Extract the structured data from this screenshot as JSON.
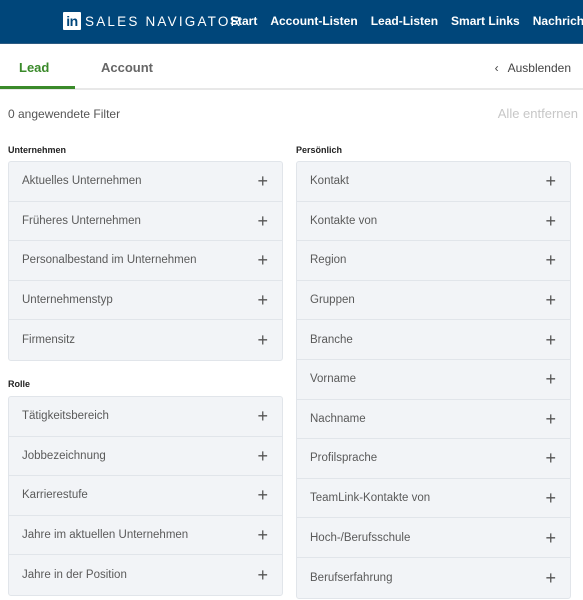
{
  "header": {
    "logo_text": "in",
    "brand": "SALES NAVIGATOR",
    "nav": [
      "Start",
      "Account-Listen",
      "Lead-Listen",
      "Smart Links",
      "Nachrichten"
    ],
    "bg_color": "#00467a"
  },
  "tabs": {
    "items": [
      "Lead",
      "Account"
    ],
    "active": "Lead",
    "accent_color": "#3a8a2a",
    "hide_label": "Ausblenden"
  },
  "filters": {
    "applied_count_text": "0 angewendete Filter",
    "remove_all": "Alle entfernen"
  },
  "sections": {
    "company": {
      "title": "Unternehmen",
      "items": [
        "Aktuelles Unternehmen",
        "Früheres Unternehmen",
        "Personalbestand im Unternehmen",
        "Unternehmenstyp",
        "Firmensitz"
      ]
    },
    "role": {
      "title": "Rolle",
      "items": [
        "Tätigkeitsbereich",
        "Jobbezeichnung",
        "Karrierestufe",
        "Jahre im aktuellen Unternehmen",
        "Jahre in der Position"
      ]
    },
    "personal": {
      "title": "Persönlich",
      "items": [
        "Kontakt",
        "Kontakte von",
        "Region",
        "Gruppen",
        "Branche",
        "Vorname",
        "Nachname",
        "Profilsprache",
        "TeamLink-Kontakte von",
        "Hoch-/Berufsschule",
        "Berufserfahrung"
      ]
    }
  },
  "icons": {
    "add": "+",
    "chevron_left": "‹"
  }
}
